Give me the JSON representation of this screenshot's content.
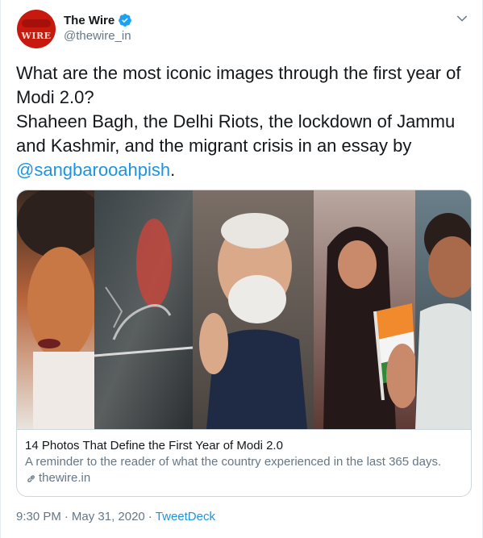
{
  "author": {
    "name": "The Wire",
    "handle": "@thewire_in",
    "avatar_logo": "WIRE",
    "verified_icon": "verified-badge-icon"
  },
  "tweet": {
    "text_lines": [
      "What are the most iconic images through the first year of",
      "Modi 2.0?",
      "Shaheen Bagh, the Delhi Riots, the lockdown of Jammu",
      "and Kashmir, and the migrant crisis in an essay by"
    ],
    "mention": "@sangbarooahpish",
    "mention_suffix": "."
  },
  "card": {
    "title": "14 Photos That Define the First Year of Modi 2.0",
    "description": "A reminder to the reader of what the country experienced in the last 365 days.",
    "domain": "thewire.in"
  },
  "meta": {
    "time": "9:30 PM",
    "separator": "·",
    "date": "May 31, 2020",
    "source": "TweetDeck"
  },
  "colors": {
    "link": "#1b95e0",
    "secondary_text": "#657786",
    "primary_text": "#14171a",
    "border": "#ccd6dd"
  }
}
